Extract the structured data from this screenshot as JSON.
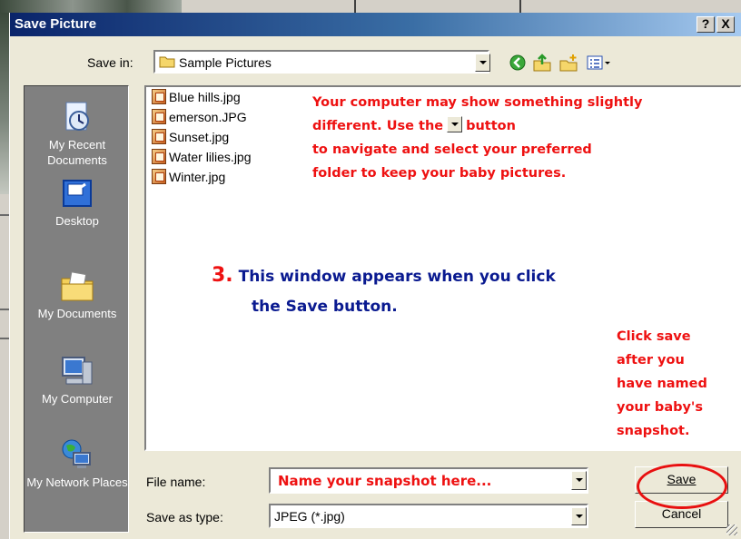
{
  "window": {
    "title": "Save Picture",
    "help_glyph": "?",
    "close_glyph": "X"
  },
  "save_in": {
    "label": "Save in:",
    "value": "Sample Pictures"
  },
  "toolbar": {
    "icons": [
      "back-icon",
      "up-folder-icon",
      "new-folder-icon",
      "view-menu-icon"
    ]
  },
  "places": [
    {
      "label": "My Recent Documents",
      "icon": "recent-documents-icon"
    },
    {
      "label": "Desktop",
      "icon": "desktop-icon"
    },
    {
      "label": "My Documents",
      "icon": "my-documents-icon"
    },
    {
      "label": "My Computer",
      "icon": "my-computer-icon"
    },
    {
      "label": "My Network Places",
      "icon": "network-places-icon"
    }
  ],
  "files": [
    "Blue hills.jpg",
    "emerson.JPG",
    "Sunset.jpg",
    "Water lilies.jpg",
    "Winter.jpg"
  ],
  "annotations": {
    "note1_line1": "Your computer may show something slightly",
    "note1_line2a": "different.  Use the",
    "note1_line2b": "button",
    "note1_line3": "to navigate and select your preferred",
    "note1_line4": "folder to keep your baby pictures.",
    "step_number": "3.",
    "step_line1": "This window appears when you click",
    "step_line2": "the Save button.",
    "save_note": [
      "Click save",
      "after you",
      "have named",
      "your baby's",
      "snapshot."
    ]
  },
  "file_name": {
    "label": "File name:",
    "value": "Name your snapshot here..."
  },
  "save_as_type": {
    "label": "Save as type:",
    "value": "JPEG (*.jpg)"
  },
  "buttons": {
    "save": "Save",
    "cancel": "Cancel"
  },
  "colors": {
    "annotation_red": "#ee1111",
    "annotation_blue": "#0a1a90",
    "title_bar": "#0a246a"
  }
}
